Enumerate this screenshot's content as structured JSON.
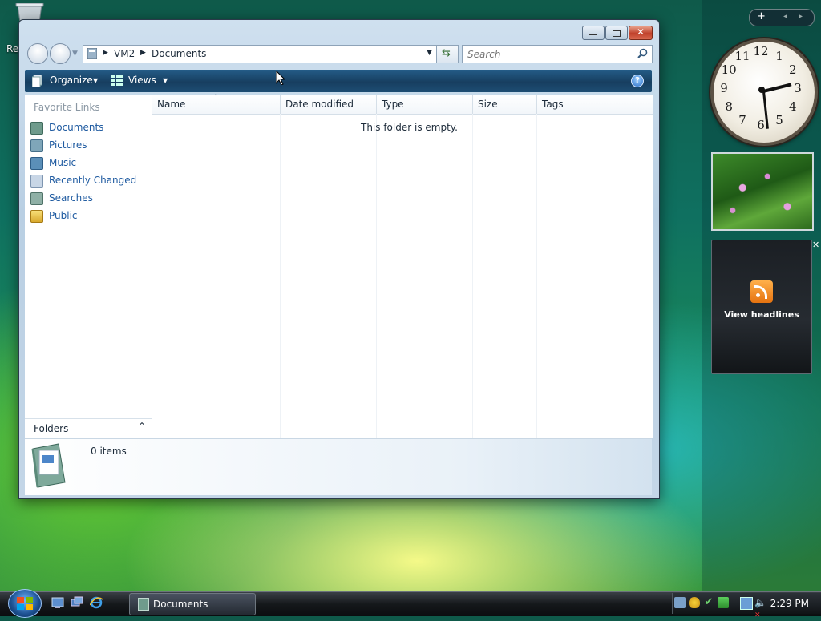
{
  "desktop": {
    "label": "Re"
  },
  "window": {
    "address": [
      "VM2",
      "Documents"
    ],
    "search_placeholder": "Search",
    "toolbar": {
      "organize": "Organize",
      "views": "Views",
      "help": "?"
    },
    "nav": {
      "heading": "Favorite Links",
      "items": [
        {
          "label": "Documents"
        },
        {
          "label": "Pictures"
        },
        {
          "label": "Music"
        },
        {
          "label": "Recently Changed"
        },
        {
          "label": "Searches"
        },
        {
          "label": "Public"
        }
      ],
      "folders": "Folders"
    },
    "columns": [
      "Name",
      "Date modified",
      "Type",
      "Size",
      "Tags"
    ],
    "empty_message": "This folder is empty.",
    "details": {
      "count": "0 items"
    }
  },
  "sidebar": {
    "clock_numbers": [
      "12",
      "1",
      "2",
      "3",
      "4",
      "5",
      "6",
      "7",
      "8",
      "9",
      "10",
      "11"
    ],
    "feed_label": "View headlines"
  },
  "taskbar": {
    "task": "Documents",
    "time": "2:29 PM"
  }
}
